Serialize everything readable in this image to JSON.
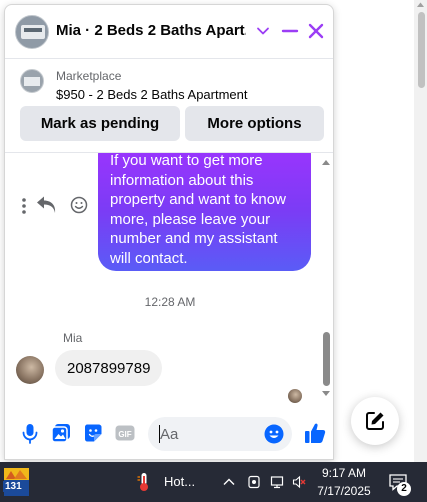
{
  "chat": {
    "title": "Mia · 2 Beds 2 Baths Apart...",
    "listing": {
      "source": "Marketplace",
      "title": "$950 - 2 Beds 2 Baths Apartment",
      "pending_label": "Mark as pending",
      "more_label": "More options"
    },
    "messages": {
      "outgoing_text": "If you want to get more information about this property and want to know more, please leave your number and my assistant will contact.",
      "timestamp": "12:28 AM",
      "sender_name": "Mia",
      "incoming_text": "2087899789"
    },
    "composer": {
      "placeholder": "Aa"
    }
  },
  "taskbar": {
    "app_badge": "131",
    "weather_text": "Hot...",
    "time": "9:17 AM",
    "date": "7/17/2025",
    "notification_count": "2"
  },
  "colors": {
    "messenger_purple": "#a033ff",
    "messenger_blue": "#0866ff",
    "taskbar_bg": "#262a36"
  },
  "icons": {
    "header": [
      "chevron-down-icon",
      "minimize-icon",
      "close-icon"
    ],
    "message_actions": [
      "more-vertical-icon",
      "reply-icon",
      "emoji-react-icon"
    ],
    "composer": [
      "microphone-icon",
      "photo-icon",
      "sticker-icon",
      "gif-icon",
      "emoji-icon",
      "thumbs-up-icon"
    ],
    "fab": "compose-icon",
    "taskbar": [
      "thermometer-icon",
      "chevron-up-icon",
      "location-icon",
      "network-icon",
      "volume-muted-icon",
      "notification-icon"
    ]
  }
}
